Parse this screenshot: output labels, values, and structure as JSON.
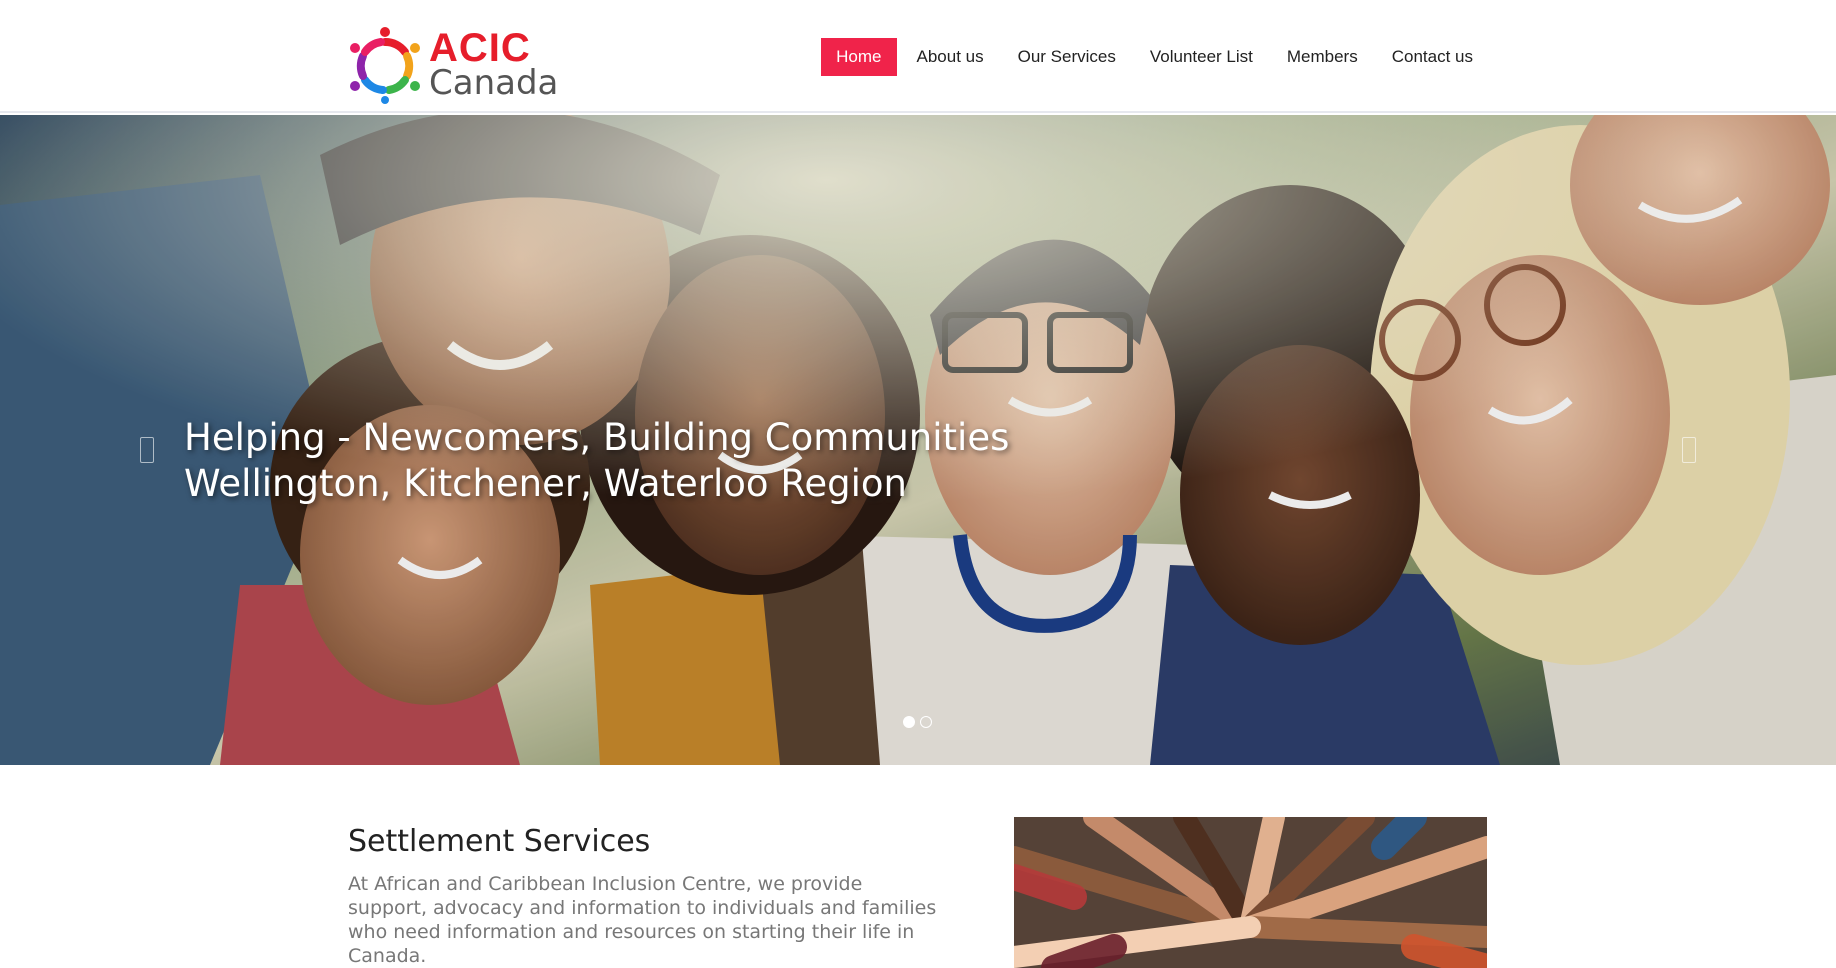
{
  "logo": {
    "line1": "ACIC",
    "line2": "Canada"
  },
  "nav": {
    "items": [
      {
        "label": "Home",
        "active": true
      },
      {
        "label": "About us"
      },
      {
        "label": "Our Services"
      },
      {
        "label": "Volunteer List"
      },
      {
        "label": "Members"
      },
      {
        "label": "Contact us"
      }
    ]
  },
  "hero": {
    "line1": "Helping - Newcomers, Building Communities",
    "line2": "Wellington, Kitchener, Waterloo Region",
    "slides": 2,
    "active_slide": 1
  },
  "settlement": {
    "title": "Settlement Services",
    "body": "At African and Caribbean Inclusion Centre, we provide support, advocacy and information to individuals and families who need information and resources on starting their life in Canada."
  },
  "colors": {
    "accent": "#f0234a",
    "logo_red": "#e61e2b"
  }
}
